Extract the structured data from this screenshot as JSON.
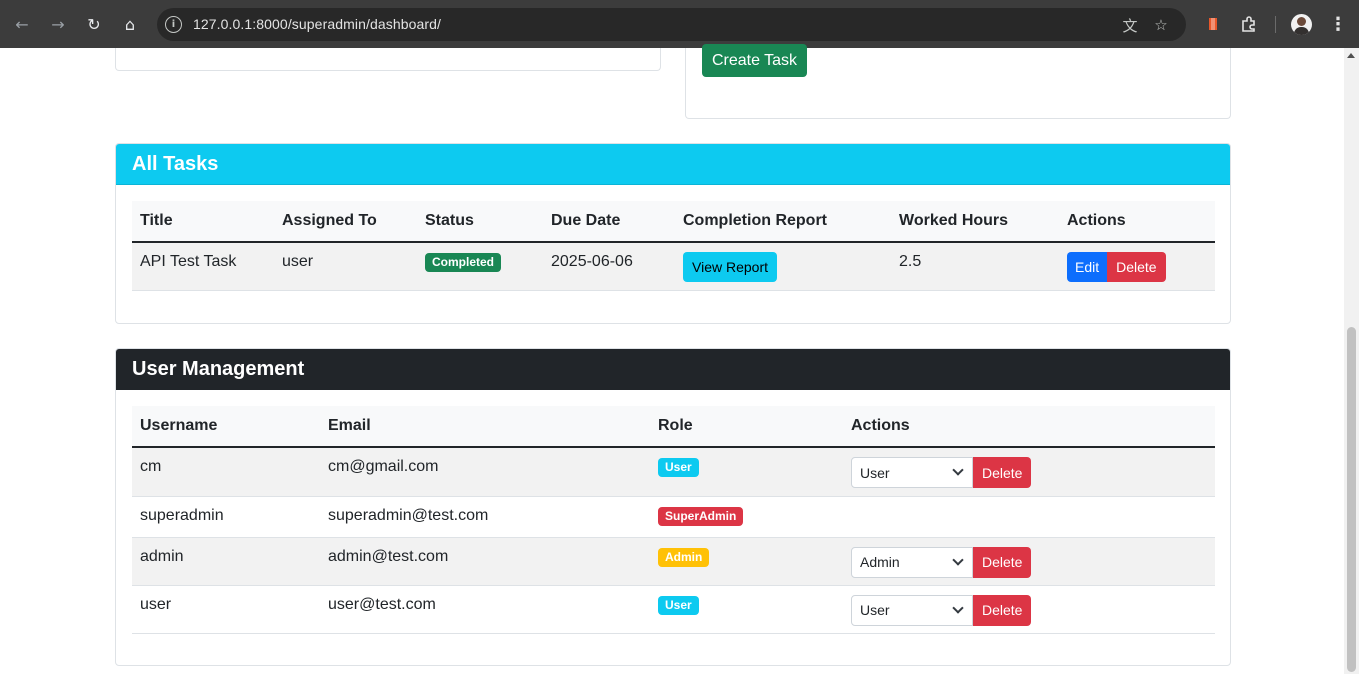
{
  "browser": {
    "url": "127.0.0.1:8000/superadmin/dashboard/"
  },
  "top_section": {
    "create_task_label": "Create Task"
  },
  "tasks": {
    "header": "All Tasks",
    "columns": [
      "Title",
      "Assigned To",
      "Status",
      "Due Date",
      "Completion Report",
      "Worked Hours",
      "Actions"
    ],
    "rows": [
      {
        "title": "API Test Task",
        "assigned_to": "user",
        "status": "Completed",
        "due_date": "2025-06-06",
        "report_label": "View Report",
        "worked_hours": "2.5",
        "edit_label": "Edit",
        "delete_label": "Delete"
      }
    ]
  },
  "users": {
    "header": "User Management",
    "columns": [
      "Username",
      "Email",
      "Role",
      "Actions"
    ],
    "rows": [
      {
        "username": "cm",
        "email": "cm@gmail.com",
        "role": "User",
        "select_value": "User",
        "delete_label": "Delete"
      },
      {
        "username": "superadmin",
        "email": "superadmin@test.com",
        "role": "SuperAdmin"
      },
      {
        "username": "admin",
        "email": "admin@test.com",
        "role": "Admin",
        "select_value": "Admin",
        "delete_label": "Delete"
      },
      {
        "username": "user",
        "email": "user@test.com",
        "role": "User",
        "select_value": "User",
        "delete_label": "Delete"
      }
    ]
  },
  "colors": {
    "info": "#0dcaf0",
    "success": "#198754",
    "danger": "#dc3545",
    "warning": "#ffc107",
    "primary": "#0d6efd",
    "dark": "#212529"
  },
  "icons": [
    "back-icon",
    "forward-icon",
    "reload-icon",
    "home-icon",
    "site-info-icon",
    "translate-icon",
    "star-icon",
    "extension-icon",
    "puzzle-icon",
    "avatar",
    "menu-icon"
  ]
}
